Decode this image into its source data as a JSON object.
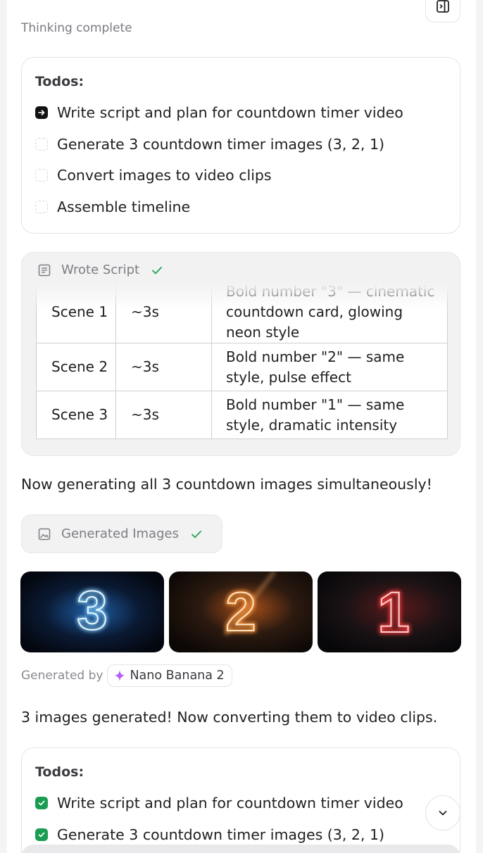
{
  "header": {
    "thinking_status": "Thinking complete"
  },
  "todos_top": {
    "title": "Todos:",
    "items": [
      {
        "label": "Write script and plan for countdown timer video",
        "state": "active"
      },
      {
        "label": "Generate 3 countdown timer images (3, 2, 1)",
        "state": "pending"
      },
      {
        "label": "Convert images to video clips",
        "state": "pending"
      },
      {
        "label": "Assemble timeline",
        "state": "pending"
      }
    ]
  },
  "script_card": {
    "title": "Wrote Script",
    "status_icon": "check-icon",
    "rows": [
      {
        "scene": "Scene 1",
        "duration": "~3s",
        "description": "Bold number \"3\" — cinematic countdown card, glowing neon style"
      },
      {
        "scene": "Scene 2",
        "duration": "~3s",
        "description": "Bold number \"2\" — same style, pulse effect"
      },
      {
        "scene": "Scene 3",
        "duration": "~3s",
        "description": "Bold number \"1\" — same style, dramatic intensity"
      }
    ]
  },
  "messages": {
    "generating": "Now generating all 3 countdown images simultaneously!",
    "generated": "3 images generated! Now converting them to video clips."
  },
  "generated_images": {
    "title": "Generated Images",
    "status_icon": "check-icon",
    "images": [
      {
        "digit": "3",
        "color": "#4fb8ff",
        "theme": "blue neon"
      },
      {
        "digit": "2",
        "color": "#ff8a2a",
        "theme": "orange neon"
      },
      {
        "digit": "1",
        "color": "#ff3b3b",
        "theme": "red neon"
      }
    ],
    "generated_by_label": "Generated by",
    "model_name": "Nano Banana 2"
  },
  "todos_bottom": {
    "title": "Todos:",
    "items": [
      {
        "label": "Write script and plan for countdown timer video",
        "state": "done"
      },
      {
        "label": "Generate 3 countdown timer images (3, 2, 1)",
        "state": "done"
      }
    ]
  },
  "colors": {
    "accent_done": "#1a9d52",
    "check_green": "#22a455",
    "muted_text": "#7d7d83"
  }
}
